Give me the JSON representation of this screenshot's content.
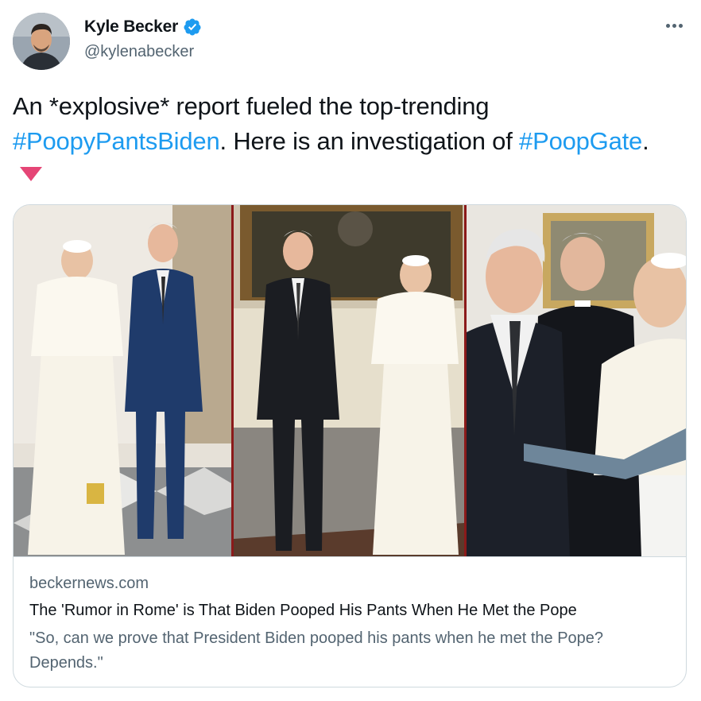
{
  "author": {
    "display_name": "Kyle Becker",
    "handle": "@kylenabecker",
    "verified": true,
    "avatar_icon": "profile-photo"
  },
  "menu": {
    "icon": "more-horizontal-icon"
  },
  "tweet": {
    "segments": [
      {
        "text": "An *explosive* report fueled the top-trending ",
        "type": "text"
      },
      {
        "text": "#PoopyPantsBiden",
        "type": "hashtag"
      },
      {
        "text": ". Here is an investigation of ",
        "type": "text"
      },
      {
        "text": "#PoopGate",
        "type": "hashtag"
      },
      {
        "text": ".",
        "type": "text"
      }
    ],
    "emoji_icon": "red-down-triangle-icon"
  },
  "card": {
    "domain": "beckernews.com",
    "title": "The 'Rumor in Rome' is That Biden Pooped His Pants When He Met the Pope",
    "description": "\"So, can we prove that President Biden pooped his pants when he met the Pope? Depends.\"",
    "image_icon": "collage-photo"
  },
  "colors": {
    "link": "#1d9bf0",
    "secondary_text": "#536471",
    "border": "#cfd9de",
    "triangle": "#e0245e"
  }
}
